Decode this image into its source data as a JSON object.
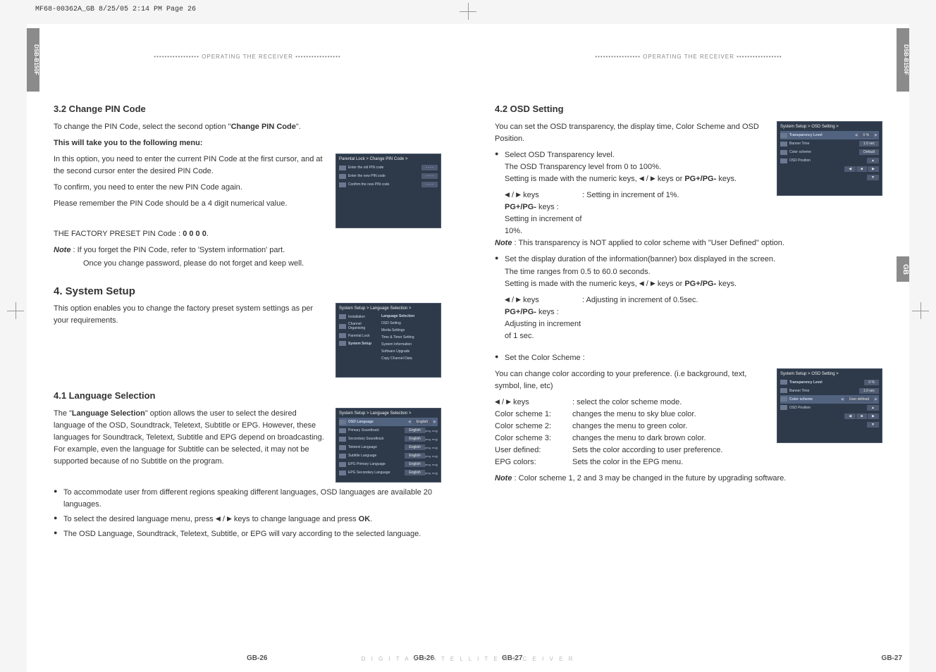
{
  "print_header": "MF68-00362A_GB  8/25/05  2:14 PM  Page 26",
  "model": "DSB-B150F",
  "gb_tab": "GB",
  "header_text": "•••••••••••••••••   OPERATING THE RECEIVER   •••••••••••••••••",
  "footer_text": "D   I   G   I   T   A   L         S   A   T   E   L   L   I   T   E         R   E   C   E   I   V   E   R",
  "page_left": "GB-26",
  "page_right": "GB-27",
  "left": {
    "s32_title": "3.2 Change PIN Code",
    "s32_p1a": "To change the PIN Code, select the second option \"",
    "s32_p1b": "Change PIN Code",
    "s32_p1c": "\".",
    "s32_p2": "This will take you to the following menu:",
    "s32_p3": "In this option, you need to enter the current PIN Code at the first cursor, and at the second cursor enter the desired PIN Code.",
    "s32_p4": "To confirm, you need to enter the new PIN Code again.",
    "s32_p5": "Please remember the PIN Code should be a 4 digit numerical value.",
    "s32_p6a": "THE FACTORY PRESET PIN Code : ",
    "s32_p6b": "0 0 0 0",
    "s32_p6c": ".",
    "s32_note1": "If you forget the PIN Code, refer to 'System information' part.",
    "s32_note2": "Once you change password, please do not forget and keep well.",
    "s4_title": "4. System Setup",
    "s4_p1": "This option enables you to change the factory preset system settings as per your requirements.",
    "s41_title": "4.1 Language Selection",
    "s41_p1a": "The \"",
    "s41_p1b": "Language Selection",
    "s41_p1c": "\" option allows the user to select the desired language of the OSD, Soundtrack, Teletext, Subtitle or EPG. However, these languages for Soundtrack, Teletext, Subtitle and EPG depend on broadcasting. For example, even the language for Subtitle can be selected, it may not be supported because of no Subtitle on the program.",
    "s41_b1": "To accommodate user from different regions speaking different languages, OSD languages are available 20 languages.",
    "s41_b2a": "To select the desired language menu, press ",
    "s41_b2b": " keys to change language and press ",
    "s41_b2c": "OK",
    "s41_b2d": ".",
    "s41_b3": "The OSD Language, Soundtrack, Teletext, Subtitle, or EPG will vary according to the selected language.",
    "shot1": {
      "breadcrumb": "Parental Lock > Change PIN Code >",
      "r1": "Enter the old PIN code",
      "r2": "Enter the new PIN code",
      "r3": "Confirm the new PIN code",
      "mask": "- - - -"
    },
    "shot2": {
      "breadcrumb": "System Setup > Language Selection >",
      "side1": "Installation",
      "side2": "Channel Organising",
      "side3": "Parental Lock",
      "side4": "System Setup",
      "m1": "Language Selection",
      "m2": "OSD Setting",
      "m3": "Media Settings",
      "m4": "Time & Timer Setting",
      "m5": "System Information",
      "m6": "Software Upgrade",
      "m7": "Copy Channel Data"
    },
    "shot3": {
      "breadcrumb": "System Setup > Language Selection >",
      "r1": "OSD Language",
      "v1": "English",
      "r2": "Primary Soundtrack",
      "v2a": "English",
      "v2b": "(eng, eng)",
      "r3": "Secondary Soundtrack",
      "v3a": "English",
      "v3b": "(eng, eng)",
      "r4": "Teletext Language",
      "v4a": "English",
      "v4b": "(eng, eng)",
      "r5": "Subtitle Language",
      "v5a": "English",
      "v5b": "(eng, eng)",
      "r6": "EPG Primary Language",
      "v6a": "English",
      "v6b": "(eng, eng)",
      "r7": "EPG Secondary Language",
      "v7a": "English",
      "v7b": "(eng, eng)"
    }
  },
  "right": {
    "s42_title": "4.2 OSD Setting",
    "s42_p1": "You can set the OSD transparency, the display time, Color Scheme and OSD Position.",
    "s42_b1a": "Select OSD Transparency level.",
    "s42_b1b": "The OSD Transparency level from 0 to 100%.",
    "s42_b1c_a": "Setting is made with the numeric keys, ",
    "s42_b1c_b": " keys or ",
    "s42_b1c_c": "PG+/PG-",
    "s42_b1c_d": " keys.",
    "s42_k1a": " keys",
    "s42_k1b": ": Setting in increment of 1%.",
    "s42_k2a": "PG+/PG-",
    "s42_k2b": " keys : Setting in increment of 10%.",
    "s42_note1": "This transparency is NOT applied to color scheme with \"User Defined\" option.",
    "s42_b2a": "Set the display duration of the information(banner) box displayed in the screen.",
    "s42_b2b": "The time ranges from 0.5 to 60.0 seconds.",
    "s42_b2c_a": "Setting is made with the numeric keys, ",
    "s42_b2c_b": " keys or ",
    "s42_b2c_c": "PG+/PG-",
    "s42_b2c_d": " keys.",
    "s42_k3a": " keys",
    "s42_k3b": ": Adjusting in increment of 0.5sec.",
    "s42_k4a": "PG+/PG-",
    "s42_k4b": " keys : Adjusting in increment of 1 sec.",
    "s42_b3": "Set the Color Scheme :",
    "s42_p2": "You can change color according to your preference. (i.e background, text, symbol, line, etc)",
    "s42_d0a": " keys",
    "s42_d0b": ": select the color scheme mode.",
    "s42_d1a": "Color scheme 1:",
    "s42_d1b": "changes the menu to sky blue color.",
    "s42_d2a": "Color scheme 2:",
    "s42_d2b": "changes the menu to green color.",
    "s42_d3a": "Color scheme 3:",
    "s42_d3b": "changes the menu to dark brown color.",
    "s42_d4a": "User defined:",
    "s42_d4b": "Sets the color according to user preference.",
    "s42_d5a": "EPG colors:",
    "s42_d5b": "Sets the color in the EPG menu.",
    "s42_note2": "Color scheme 1, 2 and 3 may be changed in the future by upgrading software.",
    "shot4": {
      "breadcrumb": "System Setup > OSD Setting >",
      "r1": "Transparency Level",
      "v1": "0 %",
      "r2": "Banner Time",
      "v2": "1.0 sec",
      "r3": "Color scheme",
      "v3": "Default",
      "r4": "OSD Position"
    },
    "shot5": {
      "breadcrumb": "System Setup > OSD Setting >",
      "r1": "Transparency Level",
      "v1": "0 %",
      "r2": "Banner Time",
      "v2": "1.0 sec",
      "r3": "Color scheme",
      "v3": "User defined",
      "r4": "OSD Position"
    }
  },
  "note_label": "Note",
  "colon": " : "
}
